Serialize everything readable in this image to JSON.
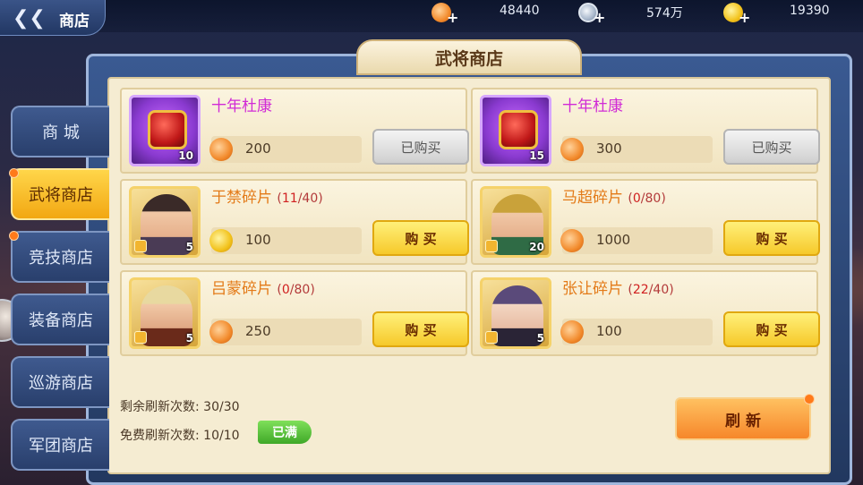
{
  "header": {
    "back_label": "商店",
    "panel_title": "武将商店"
  },
  "resources": [
    {
      "icon": "jade-icon",
      "value": "48440"
    },
    {
      "icon": "silver-coin-icon",
      "value": "574万"
    },
    {
      "icon": "gold-ingot-icon",
      "value": "19390"
    }
  ],
  "sidebar": {
    "items": [
      {
        "label": "商 城"
      },
      {
        "label": "武将商店"
      },
      {
        "label": "竞技商店"
      },
      {
        "label": "装备商店"
      },
      {
        "label": "巡游商店"
      },
      {
        "label": "军团商店"
      }
    ]
  },
  "items": [
    {
      "name": "十年杜康",
      "progress_current": "",
      "progress_total": "",
      "count": "10",
      "price": "200",
      "currency": "jade-icon",
      "button": "已购买"
    },
    {
      "name": "十年杜康",
      "progress_current": "",
      "progress_total": "",
      "count": "15",
      "price": "300",
      "currency": "jade-icon",
      "button": "已购买"
    },
    {
      "name": "于禁碎片",
      "progress_current": "11",
      "progress_total": "40",
      "count": "5",
      "price": "100",
      "currency": "gold-ingot-icon",
      "button": "购 买"
    },
    {
      "name": "马超碎片",
      "progress_current": "0",
      "progress_total": "80",
      "count": "20",
      "price": "1000",
      "currency": "jade-icon",
      "button": "购 买"
    },
    {
      "name": "吕蒙碎片",
      "progress_current": "0",
      "progress_total": "80",
      "count": "5",
      "price": "250",
      "currency": "jade-icon",
      "button": "购 买"
    },
    {
      "name": "张让碎片",
      "progress_current": "22",
      "progress_total": "40",
      "count": "5",
      "price": "100",
      "currency": "jade-icon",
      "button": "购 买"
    }
  ],
  "footer": {
    "remaining_label": "剩余刷新次数: 30/30",
    "free_label": "免费刷新次数: 10/10",
    "full_badge": "已满",
    "refresh_label": "刷 新"
  },
  "colors": {
    "accent": "#f6c92a",
    "name_purple": "#d12bd6",
    "name_orange": "#e37a18"
  }
}
